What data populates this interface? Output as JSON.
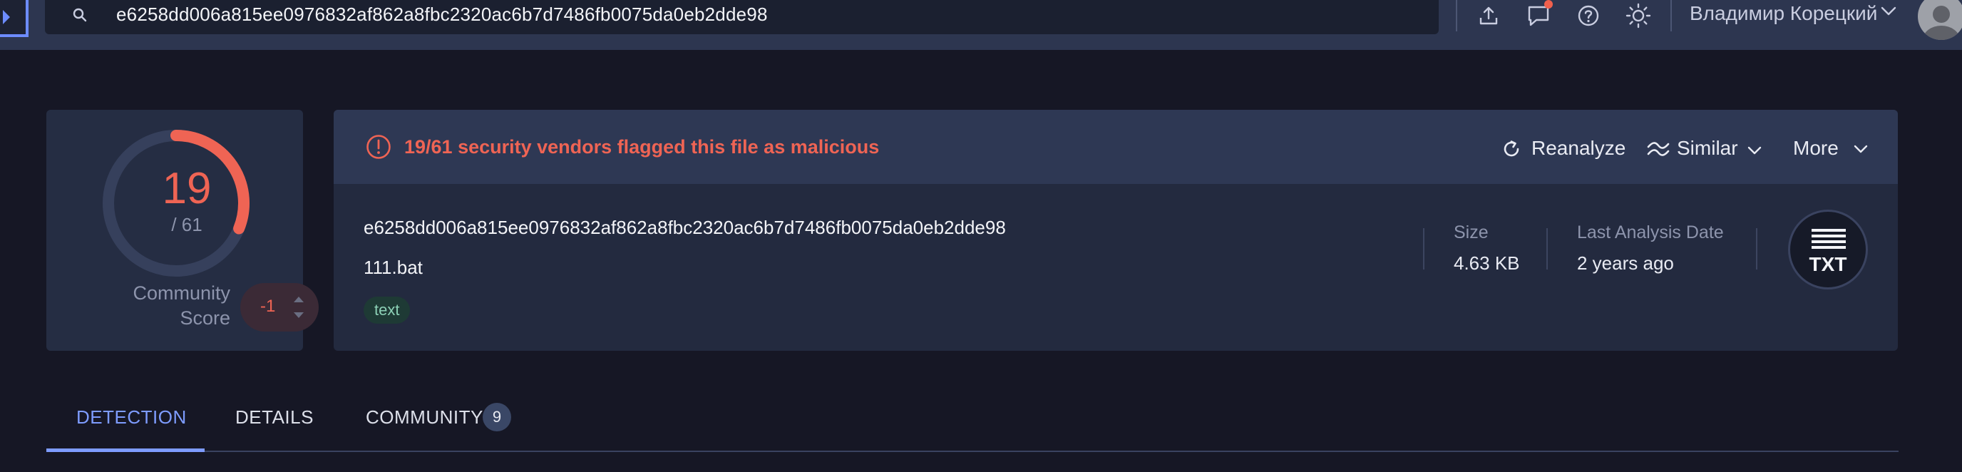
{
  "search": {
    "value": "e6258dd006a815ee0976832af862a8fbc2320ac6b7d7486fb0075da0eb2dde98"
  },
  "header": {
    "icons": [
      "upload-icon",
      "chat-icon",
      "help-icon",
      "theme-toggle-icon"
    ],
    "user_name": "Владимир Корецкий"
  },
  "score": {
    "detections": "19",
    "total": "/ 61",
    "detected_fraction": 0.311,
    "community_label_line1": "Community",
    "community_label_line2": "Score",
    "community_value": "-1"
  },
  "alert": {
    "text": "19/61 security vendors flagged this file as malicious"
  },
  "actions": {
    "reanalyze": "Reanalyze",
    "similar": "Similar",
    "more": "More"
  },
  "file": {
    "hash": "e6258dd006a815ee0976832af862a8fbc2320ac6b7d7486fb0075da0eb2dde98",
    "name": "111.bat",
    "tag": "text",
    "size_label": "Size",
    "size_value": "4.63 KB",
    "date_label": "Last Analysis Date",
    "date_value": "2 years ago",
    "type_badge": "TXT"
  },
  "tabs": [
    {
      "label": "DETECTION",
      "active": true
    },
    {
      "label": "DETAILS",
      "active": false
    },
    {
      "label": "COMMUNITY",
      "active": false,
      "count": "9"
    }
  ],
  "colors": {
    "malicious": "#ef6454",
    "accent": "#7e9cff",
    "background": "#161725",
    "card": "#232a3f",
    "topbar": "#2d3650"
  }
}
